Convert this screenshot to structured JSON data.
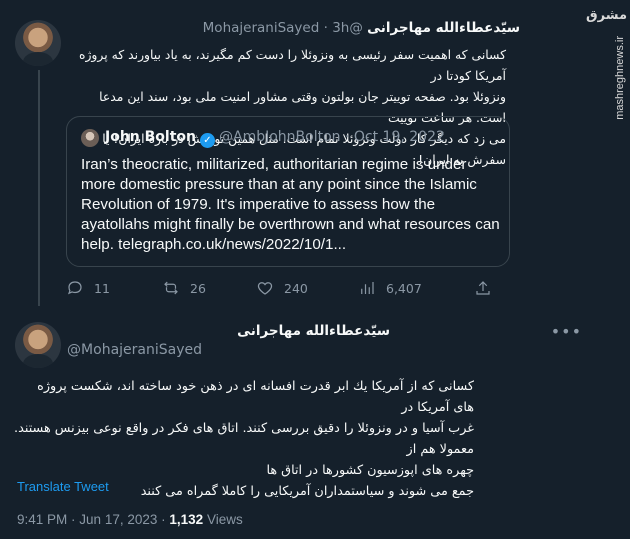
{
  "tweet1": {
    "display_name": "سیّدعطاءالله مهاجرانی",
    "handle": "@MohajeraniSayed",
    "time": "3h",
    "text_lines": [
      "کسانی که اهمیت سفر رئیسی به ونزوئلا را دست کم مگیرند، به یاد بیاورند که پروژه آمریکا کودتا در",
      "ونزوئلا بود. صفحه توییتر جان بولتون وقتی مشاور امنیت ملی بود، سند این مدعا است. هر ساعت توییت",
      "می زد که دیگر کار دولت ونزوئلا تمام است. مثل همین توییتش در باره ایران! یا سفرش به ایران!"
    ],
    "quote": {
      "name": "John Bolton",
      "handle": "@AmbJohnBolton",
      "date": "Oct 19, 2022",
      "text": "Iran’s theocratic, militarized, authoritarian regime is under more domestic pressure than at any point since the Islamic Revolution of 1979. It's imperative to assess how the ayatollahs might finally be overthrown and what resources can help. telegraph.co.uk/news/2022/10/1..."
    },
    "replies": "11",
    "retweets": "26",
    "likes": "240",
    "views": "6,407"
  },
  "tweet2": {
    "display_name": "سیّدعطاءالله مهاجرانی",
    "handle": "@MohajeraniSayed",
    "text_lines": [
      "کسانی که از آمریکا یك ابر قدرت افسانه ای در ذهن خود ساخته اند، شکست پروژه های آمریکا در",
      "غرب آسیا و در ونزوئلا را دقیق بررسی کنند. اتاق های فکر در واقع نوعی بیزنس هستند. معمولا هم از",
      "چهره های اپوزسیون کشورها در اتاق ها",
      "جمع می شوند و سیاستمداران آمریکایی را کاملا گمراه می کنند"
    ],
    "translate_label": "Translate Tweet",
    "time": "9:41 PM",
    "date": "Jun 17, 2023",
    "views_count": "1,132",
    "views_label": "Views"
  },
  "watermark": {
    "logo": "مشرق",
    "site": "mashreghnews.ir"
  }
}
